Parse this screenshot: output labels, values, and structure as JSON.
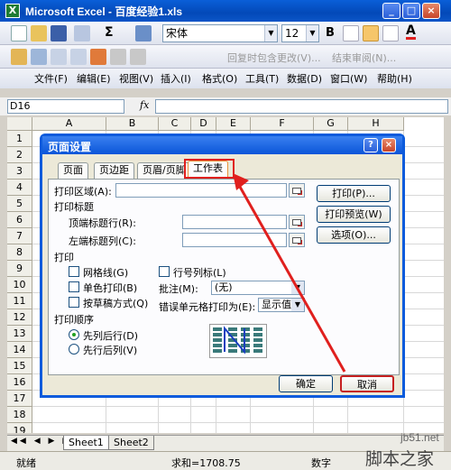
{
  "window": {
    "title": "Microsoft Excel - 百度经验1.xls",
    "app_icon": "X",
    "buttons": [
      "_",
      "□",
      "×"
    ]
  },
  "toolbar2": {
    "font_name": "宋体",
    "font_size": "12",
    "bold": "B",
    "font_color_icon": "A"
  },
  "toolbar3": {
    "reply_label": "回复时包含更改(V)...",
    "end_review_label": "结束审阅(N)..."
  },
  "menubar": {
    "items": [
      "文件(F)",
      "编辑(E)",
      "视图(V)",
      "插入(I)",
      "格式(O)",
      "工具(T)",
      "数据(D)",
      "窗口(W)",
      "帮助(H)"
    ]
  },
  "formula_bar": {
    "cell_ref": "D16",
    "fx": "fx"
  },
  "grid": {
    "columns": [
      "A",
      "B",
      "C",
      "D",
      "E",
      "F",
      "G",
      "H"
    ],
    "rows": [
      "1",
      "2",
      "3",
      "4",
      "5",
      "6",
      "7",
      "8",
      "9",
      "10",
      "11",
      "12",
      "13",
      "14",
      "15",
      "16",
      "17",
      "18",
      "19"
    ]
  },
  "sheets": {
    "tabs": [
      "Sheet1",
      "Sheet2"
    ],
    "nav": [
      "◀◀",
      "◀",
      "▶",
      "▶▶"
    ]
  },
  "status": {
    "ready": "就绪",
    "sum": "求和=1708.75",
    "mode": "数字"
  },
  "watermark": {
    "site": "jb51.net",
    "brand": "脚本之家"
  },
  "dialog": {
    "title": "页面设置",
    "help": "?",
    "close": "×",
    "tabs": [
      "页面",
      "页边距",
      "页眉/页脚",
      "工作表"
    ],
    "active_tab": "工作表",
    "print_area_label": "打印区域(A):",
    "print_titles_label": "打印标题",
    "top_rows_label": "顶端标题行(R):",
    "left_cols_label": "左端标题列(C):",
    "print_label": "打印",
    "gridlines_label": "网格线(G)",
    "mono_label": "单色打印(B)",
    "draft_label": "按草稿方式(Q)",
    "rowcol_label": "行号列标(L)",
    "comments_label": "批注(M):",
    "comments_value": "(无)",
    "errors_label": "错误单元格打印为(E):",
    "errors_value": "显示值",
    "order_label": "打印顺序",
    "order_down": "先列后行(D)",
    "order_over": "先行后列(V)",
    "buttons": {
      "print": "打印(P)...",
      "preview": "打印预览(W)",
      "options": "选项(O)...",
      "ok": "确定",
      "cancel": "取消"
    }
  },
  "colors": {
    "accent": "#0c5bdc",
    "highlight": "#e0201e"
  }
}
